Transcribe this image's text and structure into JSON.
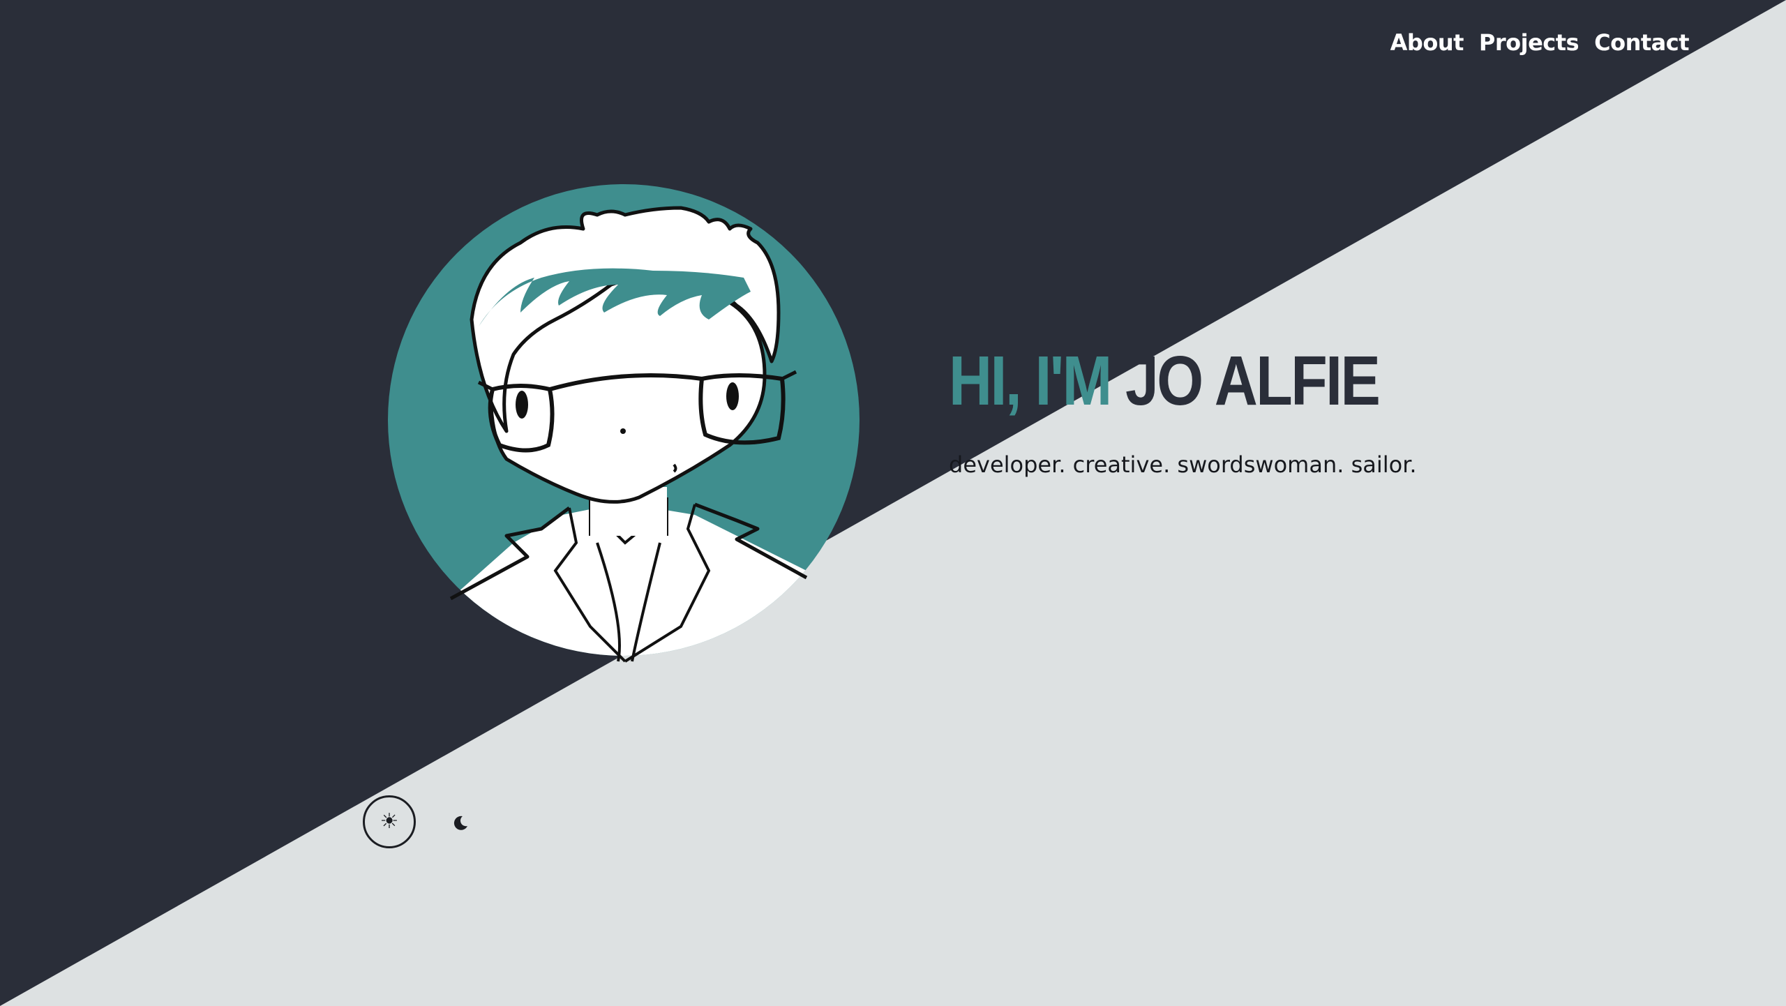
{
  "nav": {
    "items": [
      {
        "label": "About"
      },
      {
        "label": "Projects"
      },
      {
        "label": "Contact"
      }
    ]
  },
  "hero": {
    "title_part1": "HI, I'M",
    "title_part2": " JO ALFIE",
    "tagline": "developer. creative. swordswoman. sailor."
  },
  "theme_toggle": {
    "light_icon": "sun-icon",
    "dark_icon": "moon-icon",
    "selected": "light"
  },
  "colors": {
    "dark_bg": "#2a2e39",
    "light_bg": "#dde1e2",
    "accent": "#3f8e8e"
  }
}
